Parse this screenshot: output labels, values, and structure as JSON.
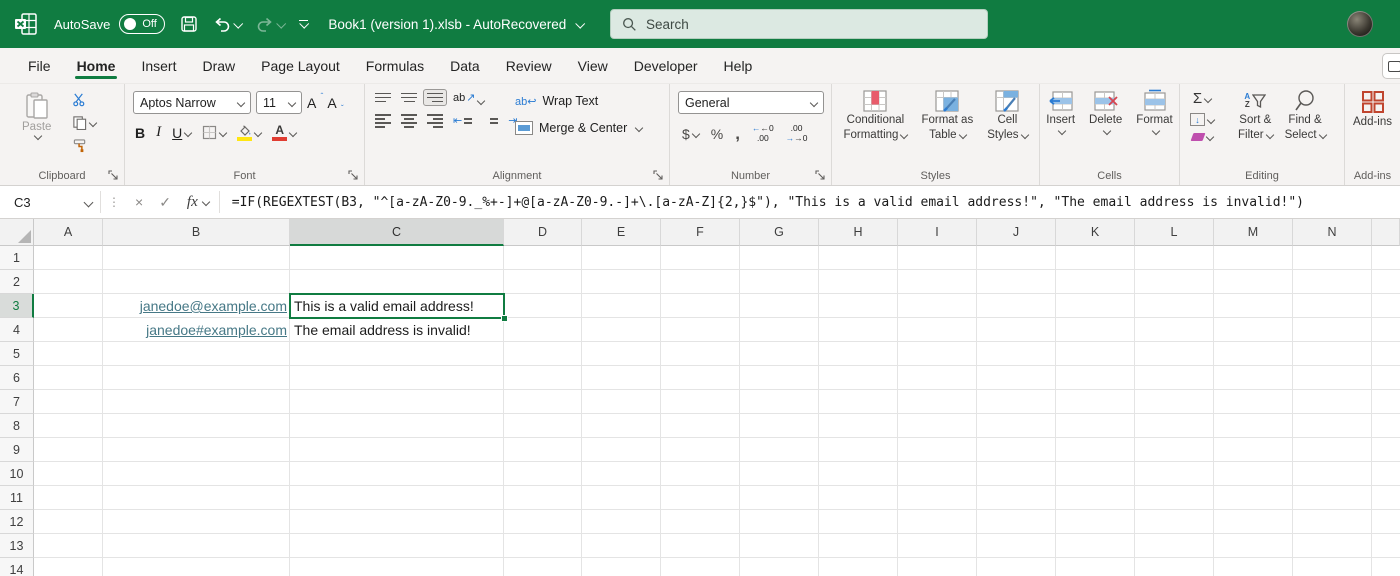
{
  "titlebar": {
    "autosave_label": "AutoSave",
    "autosave_state": "Off",
    "document_title": "Book1 (version 1).xlsb  -  AutoRecovered",
    "search_placeholder": "Search"
  },
  "ribbon_tabs": [
    {
      "label": "File",
      "active": false
    },
    {
      "label": "Home",
      "active": true
    },
    {
      "label": "Insert",
      "active": false
    },
    {
      "label": "Draw",
      "active": false
    },
    {
      "label": "Page Layout",
      "active": false
    },
    {
      "label": "Formulas",
      "active": false
    },
    {
      "label": "Data",
      "active": false
    },
    {
      "label": "Review",
      "active": false
    },
    {
      "label": "View",
      "active": false
    },
    {
      "label": "Developer",
      "active": false
    },
    {
      "label": "Help",
      "active": false
    }
  ],
  "ribbon": {
    "clipboard": {
      "group_label": "Clipboard",
      "paste_label": "Paste"
    },
    "font": {
      "group_label": "Font",
      "font_name": "Aptos Narrow",
      "font_size": "11",
      "bold": "B",
      "italic": "I",
      "underline": "U"
    },
    "alignment": {
      "group_label": "Alignment",
      "wrap_text_label": "Wrap Text",
      "merge_center_label": "Merge & Center",
      "orientation_text": "ab"
    },
    "number": {
      "group_label": "Number",
      "format_value": "General",
      "currency": "$",
      "percent": "%",
      "comma": ",",
      "inc_top": "←0",
      "inc_bottom": ".00",
      "dec_top": ".00",
      "dec_bottom": "→0"
    },
    "styles": {
      "group_label": "Styles",
      "conditional_line1": "Conditional",
      "conditional_line2": "Formatting",
      "format_table_line1": "Format as",
      "format_table_line2": "Table",
      "cell_styles_line1": "Cell",
      "cell_styles_line2": "Styles"
    },
    "cells": {
      "group_label": "Cells",
      "insert_label": "Insert",
      "delete_label": "Delete",
      "format_label": "Format"
    },
    "editing": {
      "group_label": "Editing",
      "autosum_glyph": "Σ",
      "sort_line1": "Sort &",
      "sort_line2": "Filter",
      "find_line1": "Find &",
      "find_line2": "Select",
      "sort_a": "A",
      "sort_z": "Z"
    },
    "addins": {
      "group_label": "Add-ins",
      "button_label": "Add-ins"
    }
  },
  "formula_bar": {
    "name_box": "C3",
    "more_dots": "⋮",
    "cancel_glyph": "×",
    "enter_glyph": "✓",
    "fx_label": "fx",
    "formula": "=IF(REGEXTEST(B3, \"^[a-zA-Z0-9._%+-]+@[a-zA-Z0-9.-]+\\.[a-zA-Z]{2,}$\"), \"This is a valid email address!\", \"The email address is invalid!\")"
  },
  "grid": {
    "columns": [
      "A",
      "B",
      "C",
      "D",
      "E",
      "F",
      "G",
      "H",
      "I",
      "J",
      "K",
      "L",
      "M",
      "N"
    ],
    "rows": [
      "1",
      "2",
      "3",
      "4",
      "5",
      "6",
      "7",
      "8",
      "9",
      "10",
      "11",
      "12",
      "13",
      "14"
    ],
    "selected_column": "C",
    "selected_row": "3",
    "selected_cell": "C3",
    "cells": [
      {
        "ref": "B3",
        "text": "janedoe@example.com",
        "style": "hyperlink"
      },
      {
        "ref": "B4",
        "text": "janedoe#example.com",
        "style": "hyperlink"
      },
      {
        "ref": "C3",
        "text": "This is a valid email address!",
        "style": "normal"
      },
      {
        "ref": "C4",
        "text": "The email address is invalid!",
        "style": "normal"
      }
    ]
  },
  "colors": {
    "titlebar_green": "#107C41",
    "selection_green": "#107C41",
    "hyperlink_teal": "#467886",
    "accent_blue": "#2B7CD3",
    "font_color_red": "#E03C31",
    "fill_yellow": "#FFE612",
    "addins_red": "#C0452F"
  }
}
